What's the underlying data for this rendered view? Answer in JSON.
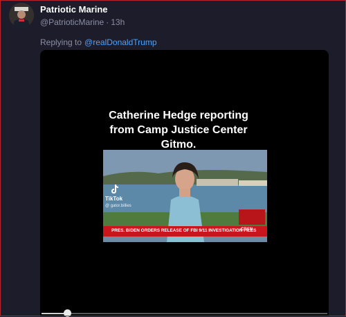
{
  "author": {
    "name": "Patriotic Marine",
    "handle": "@PatrioticMarine",
    "separator": "·",
    "time": "13h"
  },
  "reply": {
    "prefix": "Replying to",
    "mention": "@realDonaldTrump"
  },
  "video": {
    "caption_line1": "Catherine Hedge reporting",
    "caption_line2": "from Camp Justice Center",
    "caption_line3": "Gitmo.",
    "tiktok_label": "TikTok",
    "tiktok_handle": "@ gator.billies",
    "ticker": "PRES. BIDEN ORDERS RELEASE OF FBI 9/11 INVESTIGATION FILES",
    "network": "CBSN",
    "progress_percent": 9
  },
  "colors": {
    "background": "#1c1c2b",
    "mention": "#4aa3ff",
    "border": "#b3262d"
  }
}
